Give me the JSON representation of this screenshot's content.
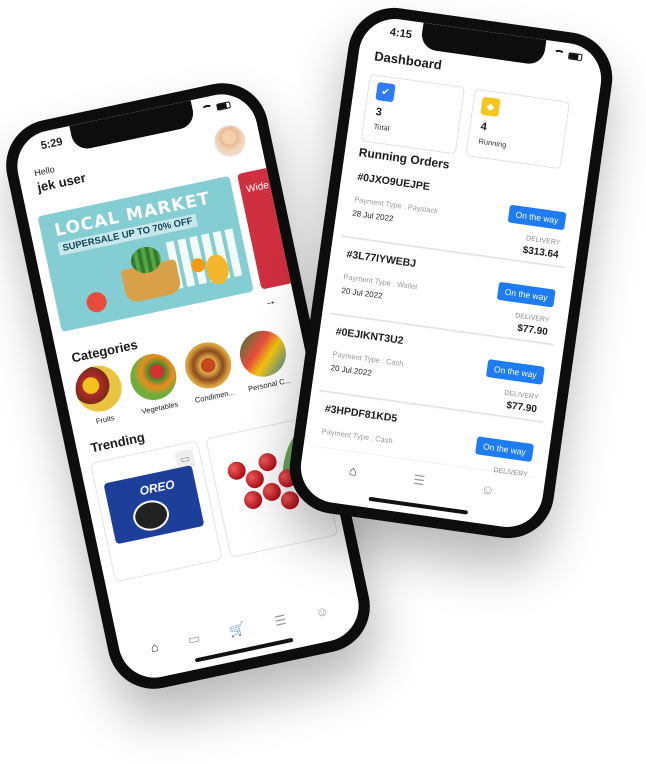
{
  "left": {
    "status_time": "5:29",
    "greeting": "Hello",
    "username": "jek user",
    "banner": {
      "title": "LOCAL MARKET",
      "subtitle": "SUPERSALE UP TO 70% OFF",
      "side_text": "Wide"
    },
    "arrow": "→",
    "categories_title": "Categories",
    "categories": [
      {
        "label": "Fruits"
      },
      {
        "label": "Vegetables"
      },
      {
        "label": "Condimen..."
      },
      {
        "label": "Personal C..."
      }
    ],
    "trending_title": "Trending",
    "products": [
      {
        "label": "OREO"
      },
      {
        "label": ""
      }
    ],
    "nav_icons": [
      "home-icon",
      "bookmark-icon",
      "cart-icon",
      "orders-icon",
      "profile-icon"
    ],
    "nav_glyphs": [
      "⌂",
      "▭",
      "🛒",
      "☰",
      "☺"
    ]
  },
  "right": {
    "status_time": "4:15",
    "title": "Dashboard",
    "stats": [
      {
        "value": "3",
        "label": "Total",
        "icon": "box-icon",
        "color": "#2d7cf6",
        "glyph": "✔"
      },
      {
        "value": "4",
        "label": "Running",
        "icon": "cube-icon",
        "color": "#f6c71a",
        "glyph": "◆"
      }
    ],
    "running_title": "Running Orders",
    "orders": [
      {
        "id": "#0JXO9UEJPE",
        "status": "On the way",
        "payment": "Payment Type : Paystack",
        "date": "28 Jul 2022",
        "type": "DELIVERY",
        "amount": "$313.64"
      },
      {
        "id": "#3L77IYWEBJ",
        "status": "On the way",
        "payment": "Payment Type : Wallet",
        "date": "20 Jul 2022",
        "type": "DELIVERY",
        "amount": "$77.90"
      },
      {
        "id": "#0EJIKNT3U2",
        "status": "On the way",
        "payment": "Payment Type : Cash",
        "date": "20 Jul 2022",
        "type": "DELIVERY",
        "amount": "$77.90"
      },
      {
        "id": "#3HPDF81KD5",
        "status": "On the way",
        "payment": "Payment Type : Cash",
        "date": "",
        "type": "DELIVERY",
        "amount": ""
      }
    ],
    "nav_glyphs": [
      "⌂",
      "☰",
      "☺"
    ]
  }
}
